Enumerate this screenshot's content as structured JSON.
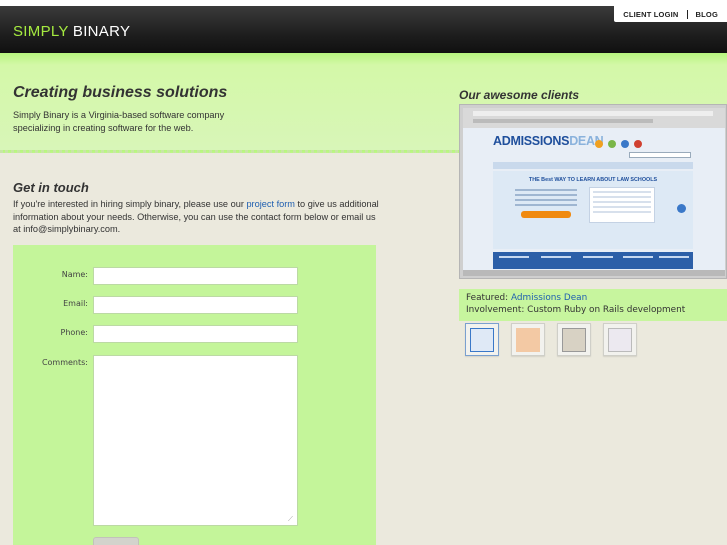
{
  "header": {
    "logo_part1": "SIMPLY",
    "logo_part2": "BINARY",
    "nav": [
      "CLIENT LOGIN",
      "BLOG"
    ]
  },
  "intro": {
    "title": "Creating business solutions",
    "text": "Simply Binary is a Virginia-based software company specializing in creating software for the web."
  },
  "contact": {
    "title": "Get in touch",
    "text_before_link": "If you're interested in hiring simply binary, please use our ",
    "link": "project form",
    "text_after_link": " to give us additional information about your needs. Otherwise, you can use the contact form below or email us at info@simplybinary.com.",
    "fields": {
      "name": "Name:",
      "email": "Email:",
      "phone": "Phone:",
      "comments": "Comments:"
    }
  },
  "clients": {
    "title": "Our awesome clients",
    "screenshot": {
      "logo_a": "ADMISSIONS",
      "logo_b": "DEAN",
      "hero_title": "THE Best WAY TO LEARN ABOUT LAW SCHOOLS"
    },
    "featured_label": "Featured: ",
    "featured_name": "Admissions Dean",
    "involvement": "Involvement: Custom Ruby on Rails development",
    "thumbnail_count": 4
  },
  "colors": {
    "accent_green": "#a5ea40",
    "panel_green": "#c4f59a",
    "link_blue": "#1f5fb0",
    "header_dark": "#1e1e1e",
    "background": "#ebe9dd"
  }
}
